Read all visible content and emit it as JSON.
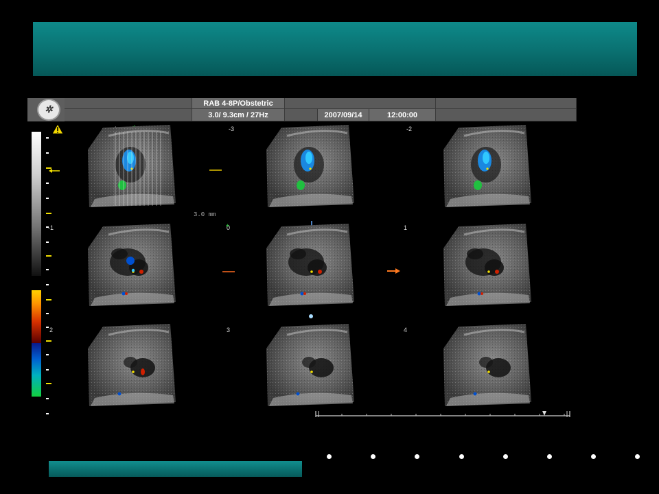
{
  "header": {
    "probe_preset": "RAB 4-8P/Obstetric",
    "scan_params": "3.0/ 9.3cm / 27Hz",
    "date": "2007/09/14",
    "time": "12:00:00",
    "logo_icon": "ge-logo-icon"
  },
  "warning_icon": "warning-triangle-icon",
  "volume_labels": [
    "-4",
    "-3",
    "-2",
    "-1",
    "0",
    "1",
    "2",
    "3",
    "4"
  ],
  "spacing_label": "3.0 mm",
  "colors": {
    "banner": "#0a7070",
    "doppler_red": "#d02000",
    "doppler_blue": "#0050d0",
    "marker_yellow": "#f3e000",
    "marker_green": "#20d040",
    "marker_orange": "#ff7a20"
  },
  "pagination": {
    "count": 8
  }
}
